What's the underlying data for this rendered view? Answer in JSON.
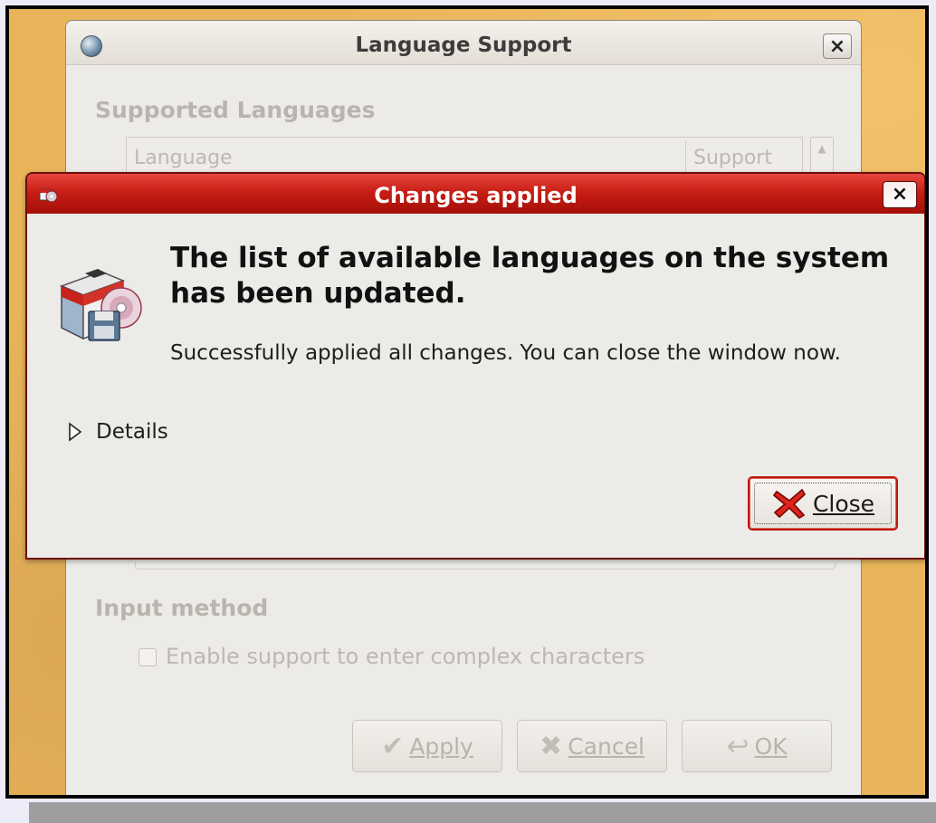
{
  "background_window": {
    "title": "Language Support",
    "close_glyph": "×",
    "supported_languages_heading": "Supported Languages",
    "columns": [
      "Language",
      "Support"
    ],
    "input_method_heading": "Input method",
    "complex_chars_label": "Enable support to enter complex characters",
    "complex_chars_checked": false,
    "buttons": {
      "apply_label": "Apply",
      "cancel_label": "Cancel",
      "ok_label": "OK"
    },
    "icons": {
      "window": "globe-icon",
      "apply": "checkmark-icon",
      "cancel": "cancel-icon",
      "ok": "ok-arrow-icon"
    }
  },
  "dialog": {
    "title": "Changes applied",
    "close_glyph": "×",
    "heading": "The list of available languages on the system has been updated.",
    "message": "Successfully applied all changes. You can close the window now.",
    "details_label": "Details",
    "details_expanded": false,
    "close_button_label": "Close",
    "icons": {
      "titlebar": "package-manager-icon",
      "main": "software-package-icon",
      "close_button": "red-x-icon"
    },
    "colors": {
      "titlebar": "#c81e15",
      "close_button_border": "#b71a10"
    }
  }
}
